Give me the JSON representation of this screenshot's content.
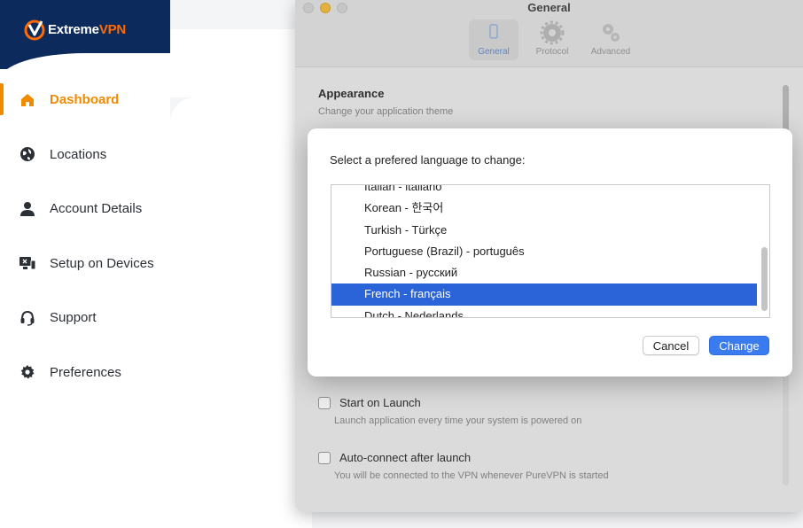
{
  "app": {
    "logo_name": "Extreme",
    "logo_suffix": "VPN"
  },
  "sidebar": {
    "items": [
      {
        "label": "Dashboard",
        "icon": "home-icon",
        "active": true
      },
      {
        "label": "Locations",
        "icon": "globe-icon"
      },
      {
        "label": "Account Details",
        "icon": "user-icon"
      },
      {
        "label": "Setup on Devices",
        "icon": "devices-icon"
      },
      {
        "label": "Support",
        "icon": "headset-icon"
      },
      {
        "label": "Preferences",
        "icon": "gear-icon"
      }
    ]
  },
  "settings_window": {
    "title": "General",
    "tabs": [
      {
        "label": "General",
        "icon": "phone-icon",
        "selected": true
      },
      {
        "label": "Protocol",
        "icon": "gear-icon"
      },
      {
        "label": "Advanced",
        "icon": "gears-icon"
      }
    ],
    "appearance": {
      "heading": "Appearance",
      "subtitle": "Change your application theme"
    },
    "start_on_launch": {
      "label": "Start on Launch",
      "subtitle": "Launch application every time your system is powered on"
    },
    "auto_connect": {
      "label": "Auto-connect after launch",
      "subtitle": "You will be connected to the VPN whenever PureVPN is started"
    }
  },
  "language_dialog": {
    "prompt": "Select a prefered language to change:",
    "languages": [
      "Italian - italiano",
      "Korean - 한국어",
      "Turkish - Türkçe",
      "Portuguese (Brazil) - português",
      "Russian - русский",
      "French - français",
      "Dutch - Nederlands"
    ],
    "selected_index": 5,
    "cancel_label": "Cancel",
    "change_label": "Change"
  },
  "colors": {
    "brand_navy": "#0d2a5c",
    "brand_orange": "#f08a00",
    "accent_blue": "#3a7bf0",
    "selection_blue": "#2a64d8"
  }
}
